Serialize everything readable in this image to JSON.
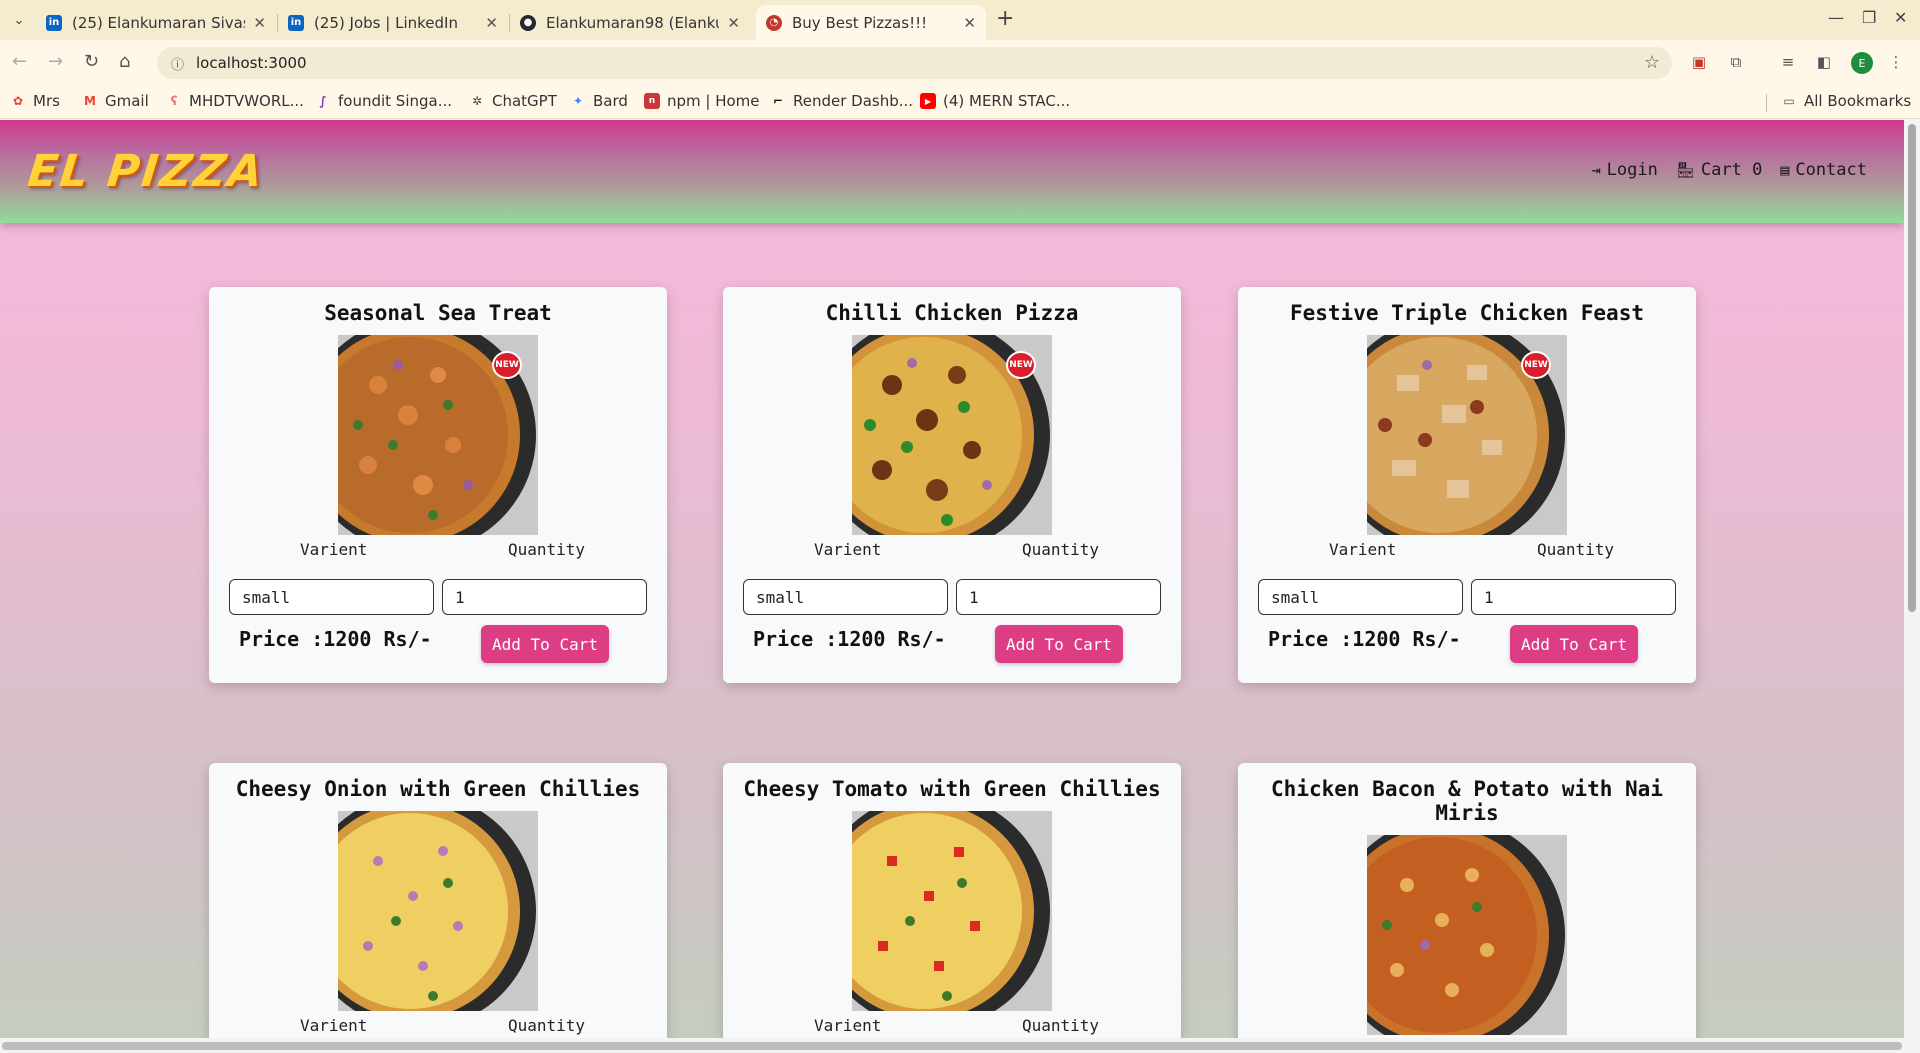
{
  "browser": {
    "tabs": [
      {
        "title": "(25) Elankumaran Sivasu",
        "favicon": "linkedin-icon"
      },
      {
        "title": "(25) Jobs | LinkedIn",
        "favicon": "linkedin-icon"
      },
      {
        "title": "Elankumaran98 (Elanku",
        "favicon": "github-icon"
      },
      {
        "title": "Buy Best Pizzas!!!",
        "favicon": "pizza-icon",
        "active": true
      }
    ],
    "url": "localhost:3000",
    "bookmarks": [
      {
        "label": "Mrs",
        "icon": "google-photos-icon"
      },
      {
        "label": "Gmail",
        "icon": "gmail-icon"
      },
      {
        "label": "MHDTVWORL...",
        "icon": "bookmark-icon"
      },
      {
        "label": "foundit Singa...",
        "icon": "foundit-icon"
      },
      {
        "label": "ChatGPT",
        "icon": "chatgpt-icon"
      },
      {
        "label": "Bard",
        "icon": "bard-icon"
      },
      {
        "label": "npm | Home",
        "icon": "npm-icon"
      },
      {
        "label": "Render Dashb...",
        "icon": "render-icon"
      },
      {
        "label": "(4) MERN STAC...",
        "icon": "youtube-icon"
      }
    ],
    "all_bookmarks": "All Bookmarks"
  },
  "site": {
    "brand": "EL PIZZA",
    "nav": {
      "login": "Login",
      "cart": "Cart 0",
      "contact": "Contact"
    }
  },
  "labels": {
    "variant": "Varient",
    "quantity": "Quantity",
    "add_to_cart": "Add To Cart"
  },
  "pizzas": [
    {
      "name": "Seasonal Sea Treat",
      "variant": "small",
      "quantity": "1",
      "price": "Price :1200 Rs/-",
      "is_new": true
    },
    {
      "name": "Chilli Chicken Pizza",
      "variant": "small",
      "quantity": "1",
      "price": "Price :1200 Rs/-",
      "is_new": true
    },
    {
      "name": "Festive Triple Chicken Feast",
      "variant": "small",
      "quantity": "1",
      "price": "Price :1200 Rs/-",
      "is_new": true
    },
    {
      "name": "Cheesy Onion with Green Chillies",
      "is_new": false
    },
    {
      "name": "Cheesy Tomato with Green Chillies",
      "is_new": false
    },
    {
      "name": "Chicken Bacon & Potato with Nai Miris",
      "is_new": false
    }
  ],
  "new_badge": "NEW",
  "colors": {
    "accent": "#dc3d85",
    "nav_top": "#cf3a8c",
    "nav_bottom": "#8fdc9c",
    "brand": "#ffd23a"
  }
}
